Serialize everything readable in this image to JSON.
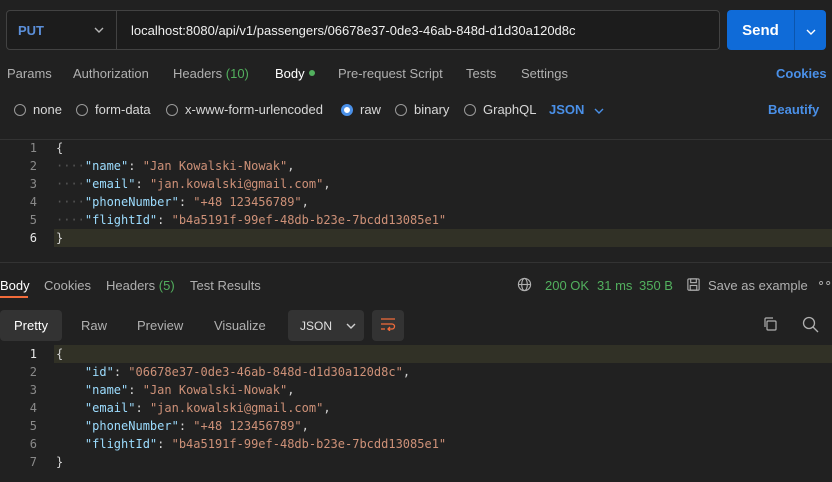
{
  "request": {
    "method": "PUT",
    "url": "localhost:8080/api/v1/passengers/06678e37-0de3-46ab-848d-d1d30a120d8c",
    "send_label": "Send"
  },
  "request_tabs": {
    "params": "Params",
    "authorization": "Authorization",
    "headers": "Headers",
    "headers_count": "(10)",
    "body": "Body",
    "pre_request": "Pre-request Script",
    "tests": "Tests",
    "settings": "Settings",
    "cookies": "Cookies"
  },
  "body_types": {
    "none": "none",
    "form_data": "form-data",
    "urlencoded": "x-www-form-urlencoded",
    "raw": "raw",
    "binary": "binary",
    "graphql": "GraphQL",
    "format": "JSON",
    "beautify": "Beautify"
  },
  "request_body": {
    "line_numbers": [
      "1",
      "2",
      "3",
      "4",
      "5",
      "6"
    ],
    "open": "{",
    "close": "}",
    "fields": [
      {
        "key": "\"name\"",
        "value": "\"Jan Kowalski-Nowak\""
      },
      {
        "key": "\"email\"",
        "value": "\"jan.kowalski@gmail.com\""
      },
      {
        "key": "\"phoneNumber\"",
        "value": "\"+48 123456789\""
      },
      {
        "key": "\"flightId\"",
        "value": "\"b4a5191f-99ef-48db-b23e-7bcdd13085e1\""
      }
    ]
  },
  "response_tabs": {
    "body": "Body",
    "cookies": "Cookies",
    "headers": "Headers",
    "headers_count": "(5)",
    "test_results": "Test Results",
    "status": "200 OK",
    "time": "31 ms",
    "size": "350 B",
    "save_example": "Save as example"
  },
  "view_tabs": {
    "pretty": "Pretty",
    "raw": "Raw",
    "preview": "Preview",
    "visualize": "Visualize",
    "format": "JSON"
  },
  "response_body": {
    "line_numbers": [
      "1",
      "2",
      "3",
      "4",
      "5",
      "6",
      "7"
    ],
    "open": "{",
    "close": "}",
    "fields": [
      {
        "key": "\"id\"",
        "value": "\"06678e37-0de3-46ab-848d-d1d30a120d8c\""
      },
      {
        "key": "\"name\"",
        "value": "\"Jan Kowalski-Nowak\""
      },
      {
        "key": "\"email\"",
        "value": "\"jan.kowalski@gmail.com\""
      },
      {
        "key": "\"phoneNumber\"",
        "value": "\"+48 123456789\""
      },
      {
        "key": "\"flightId\"",
        "value": "\"b4a5191f-99ef-48db-b23e-7bcdd13085e1\""
      }
    ]
  },
  "colors": {
    "accent_blue": "#4a90e8",
    "send_blue": "#0f6bd8",
    "success_green": "#52b05e",
    "active_underline": "#f26b3a"
  }
}
